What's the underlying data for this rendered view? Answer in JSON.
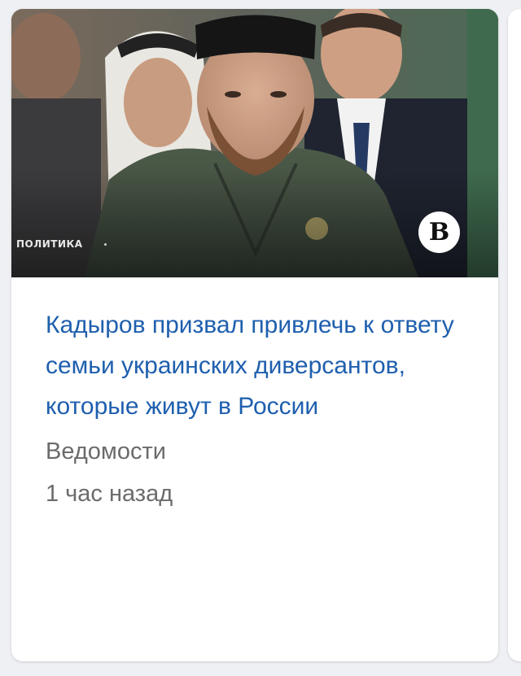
{
  "card": {
    "category": "ПОЛИТИКА",
    "source_logo": "В",
    "headline": "Кадыров призвал привлечь к ответу семьи украинских диверсантов, которые живут в России",
    "source": "Ведомости",
    "time": "1 час назад"
  },
  "colors": {
    "headline": "#1f5fae",
    "meta": "#6b6b6b",
    "background": "#eef0f3"
  }
}
